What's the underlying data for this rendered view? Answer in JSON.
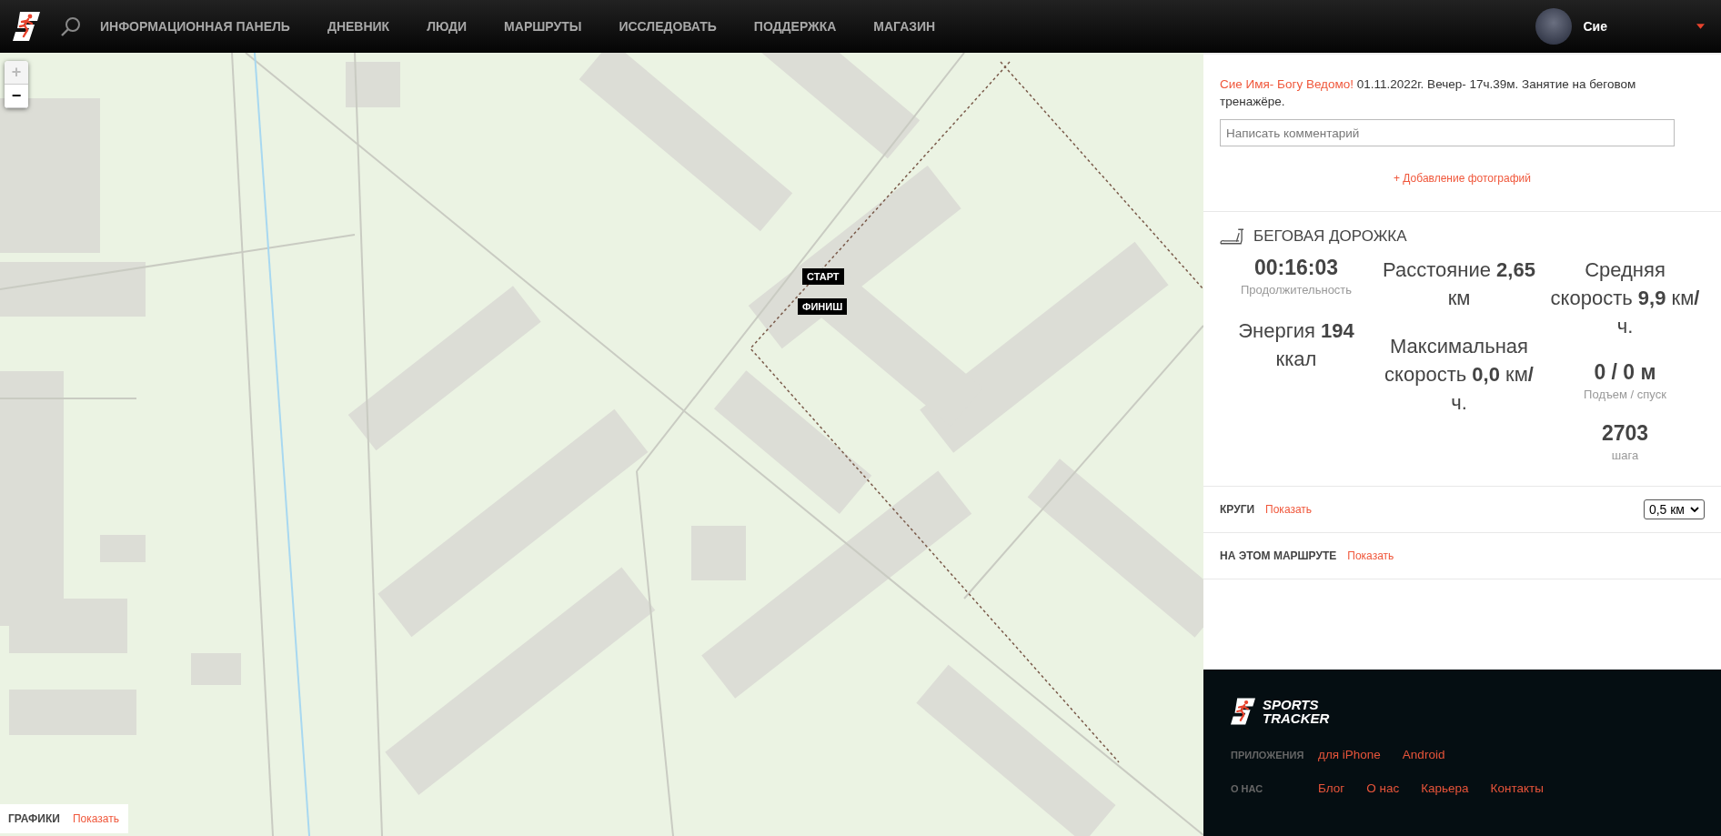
{
  "nav": {
    "items": [
      "ИНФОРМАЦИОННАЯ ПАНЕЛЬ",
      "ДНЕВНИК",
      "ЛЮДИ",
      "МАРШРУТЫ",
      "ИССЛЕДОВАТЬ",
      "ПОДДЕРЖКА",
      "МАГАЗИН"
    ],
    "user": {
      "name": "Сие"
    }
  },
  "map": {
    "zoom_controls": [
      {
        "label": "+",
        "disabled": true
      },
      {
        "label": "−",
        "disabled": false
      }
    ],
    "markers": [
      {
        "label": "СТАРТ"
      },
      {
        "label": "ФИНИШ"
      }
    ],
    "charts_panel": {
      "title": "ГРАФИКИ",
      "link": "Показать"
    }
  },
  "workout": {
    "author": "Сие Имя- Богу Ведомо!",
    "description": "01.11.2022г. Вечер- 17ч.39м. Занятие на беговом тренажёре.",
    "comment": {
      "placeholder": "Написать комментарий"
    },
    "add_photos": "+ Добавление фотографий",
    "activity": "БЕГОВАЯ ДОРОЖКА",
    "stat_columns": [
      [
        {
          "kind": "stacked",
          "value": "00:16:03",
          "caption": "Продолжительность"
        },
        {
          "kind": "inline",
          "text": "Энергия **194** ккал"
        }
      ],
      [
        {
          "kind": "inline",
          "text": "Расстояние **2,65** км"
        },
        {
          "kind": "inline",
          "text": "Максимальная скорость **0,0** км**/** ч."
        }
      ],
      [
        {
          "kind": "inline",
          "text": "Средняя скорость **9,9** км**/** ч."
        },
        {
          "kind": "stacked",
          "value": "**0 / 0** м",
          "caption": "Подъем / спуск"
        },
        {
          "kind": "stacked",
          "value": "2703",
          "caption": "шага"
        }
      ]
    ]
  },
  "sections": [
    {
      "title": "КРУГИ",
      "link": "Показать",
      "select": "0,5 км"
    },
    {
      "title": "НА ЭТОМ МАРШРУТЕ",
      "link": "Показать"
    }
  ],
  "footer": {
    "brand": [
      "SPORTS",
      "TRACKER"
    ],
    "rows": [
      {
        "label": "ПРИЛОЖЕНИЯ",
        "links": [
          "для iPhone",
          "Android"
        ]
      },
      {
        "label": "О НАС",
        "links": [
          "Блог",
          "О нас",
          "Карьера",
          "Контакты"
        ]
      }
    ]
  }
}
